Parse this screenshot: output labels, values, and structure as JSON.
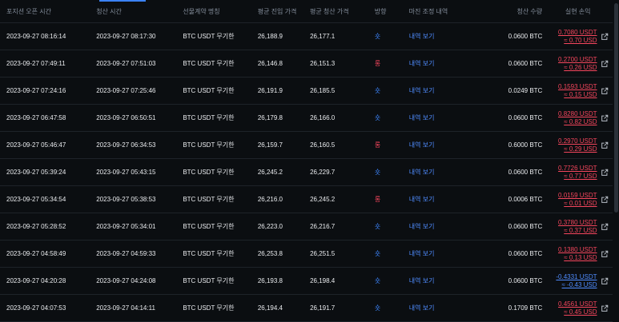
{
  "columns": {
    "open_time": "포지션 오픈 시간",
    "close_time": "청산 시간",
    "contract": "선물계약 명칭",
    "avg_entry": "평균 진입 가격",
    "avg_close": "평균 청산 가격",
    "direction": "방향",
    "margin_history": "마진 조정 내역",
    "close_qty": "청산 수량",
    "realized_pnl": "실현 손익"
  },
  "colors": {
    "buy": "#3b82f6",
    "sell": "#f6465d",
    "link": "#4f8cff"
  },
  "rows": [
    {
      "open": "2023-09-27 08:16:14",
      "close": "2023-09-27 08:17:30",
      "contract": "BTC USDT 무기한",
      "entry": "26,188.9",
      "exit": "26,177.1",
      "dir": "숏",
      "side": "buy",
      "link": "내역 보기",
      "qty": "0.0600 BTC",
      "pnl_usdt": "0.7080 USDT",
      "pnl_usd": "≈ 0.70 USD",
      "pnl_sign": "neg"
    },
    {
      "open": "2023-09-27 07:49:11",
      "close": "2023-09-27 07:51:03",
      "contract": "BTC USDT 무기한",
      "entry": "26,146.8",
      "exit": "26,151.3",
      "dir": "롱",
      "side": "sell",
      "link": "내역 보기",
      "qty": "0.0600 BTC",
      "pnl_usdt": "0.2700 USDT",
      "pnl_usd": "≈ 0.26 USD",
      "pnl_sign": "neg"
    },
    {
      "open": "2023-09-27 07:24:16",
      "close": "2023-09-27 07:25:46",
      "contract": "BTC USDT 무기한",
      "entry": "26,191.9",
      "exit": "26,185.5",
      "dir": "숏",
      "side": "buy",
      "link": "내역 보기",
      "qty": "0.0249 BTC",
      "pnl_usdt": "0.1593 USDT",
      "pnl_usd": "≈ 0.15 USD",
      "pnl_sign": "neg"
    },
    {
      "open": "2023-09-27 06:47:58",
      "close": "2023-09-27 06:50:51",
      "contract": "BTC USDT 무기한",
      "entry": "26,179.8",
      "exit": "26,166.0",
      "dir": "숏",
      "side": "buy",
      "link": "내역 보기",
      "qty": "0.0600 BTC",
      "pnl_usdt": "0.8280 USDT",
      "pnl_usd": "≈ 0.82 USD",
      "pnl_sign": "neg"
    },
    {
      "open": "2023-09-27 05:46:47",
      "close": "2023-09-27 06:34:53",
      "contract": "BTC USDT 무기한",
      "entry": "26,159.7",
      "exit": "26,160.5",
      "dir": "롱",
      "side": "sell",
      "link": "내역 보기",
      "qty": "0.6000 BTC",
      "pnl_usdt": "0.2970 USDT",
      "pnl_usd": "≈ 0.29 USD",
      "pnl_sign": "neg"
    },
    {
      "open": "2023-09-27 05:39:24",
      "close": "2023-09-27 05:43:15",
      "contract": "BTC USDT 무기한",
      "entry": "26,245.2",
      "exit": "26,229.7",
      "dir": "숏",
      "side": "buy",
      "link": "내역 보기",
      "qty": "0.0600 BTC",
      "pnl_usdt": "0.7726 USDT",
      "pnl_usd": "≈ 0.77 USD",
      "pnl_sign": "neg"
    },
    {
      "open": "2023-09-27 05:34:54",
      "close": "2023-09-27 05:38:53",
      "contract": "BTC USDT 무기한",
      "entry": "26,216.0",
      "exit": "26,245.2",
      "dir": "롱",
      "side": "sell",
      "link": "내역 보기",
      "qty": "0.0006 BTC",
      "pnl_usdt": "0.0159 USDT",
      "pnl_usd": "≈ 0.01 USD",
      "pnl_sign": "neg"
    },
    {
      "open": "2023-09-27 05:28:52",
      "close": "2023-09-27 05:34:01",
      "contract": "BTC USDT 무기한",
      "entry": "26,223.0",
      "exit": "26,216.7",
      "dir": "숏",
      "side": "buy",
      "link": "내역 보기",
      "qty": "0.0600 BTC",
      "pnl_usdt": "0.3780 USDT",
      "pnl_usd": "≈ 0.37 USD",
      "pnl_sign": "neg"
    },
    {
      "open": "2023-09-27 04:58:49",
      "close": "2023-09-27 04:59:33",
      "contract": "BTC USDT 무기한",
      "entry": "26,253.8",
      "exit": "26,251.5",
      "dir": "숏",
      "side": "buy",
      "link": "내역 보기",
      "qty": "0.0600 BTC",
      "pnl_usdt": "0.1380 USDT",
      "pnl_usd": "≈ 0.13 USD",
      "pnl_sign": "neg"
    },
    {
      "open": "2023-09-27 04:20:28",
      "close": "2023-09-27 04:24:08",
      "contract": "BTC USDT 무기한",
      "entry": "26,193.8",
      "exit": "26,198.4",
      "dir": "숏",
      "side": "buy",
      "link": "내역 보기",
      "qty": "0.0600 BTC",
      "pnl_usdt": "-0.4331 USDT",
      "pnl_usd": "≈ -0.43 USD",
      "pnl_sign": "pos"
    },
    {
      "open": "2023-09-27 04:07:53",
      "close": "2023-09-27 04:14:11",
      "contract": "BTC USDT 무기한",
      "entry": "26,194.4",
      "exit": "26,191.7",
      "dir": "숏",
      "side": "buy",
      "link": "내역 보기",
      "qty": "0.1709 BTC",
      "pnl_usdt": "0.4561 USDT",
      "pnl_usd": "≈ 0.45 USD",
      "pnl_sign": "neg"
    }
  ],
  "icon": "external-link-icon"
}
